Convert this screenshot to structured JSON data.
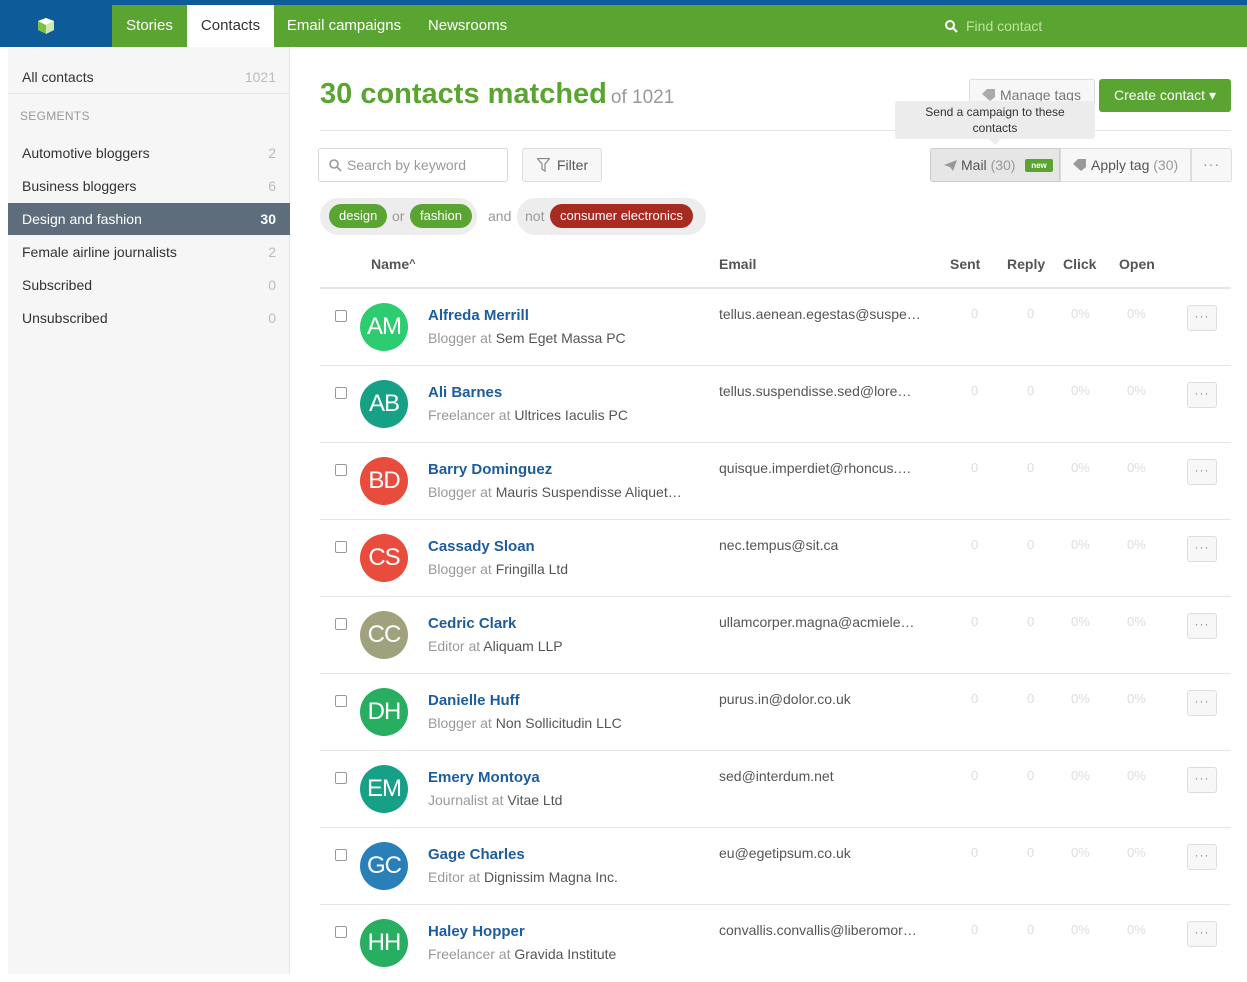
{
  "topnav": {
    "tabs": [
      "Stories",
      "Contacts",
      "Email campaigns",
      "Newsrooms"
    ],
    "active_tab": "Contacts",
    "search_placeholder": "Find contact",
    "colors": {
      "bar": "#5aa532",
      "accent_border": "#0e5b9a"
    }
  },
  "sidebar": {
    "all": {
      "label": "All contacts",
      "count": "1021"
    },
    "segments_heading": "SEGMENTS",
    "items": [
      {
        "label": "Automotive bloggers",
        "count": "2"
      },
      {
        "label": "Business bloggers",
        "count": "6"
      },
      {
        "label": "Design and fashion",
        "count": "30",
        "active": true
      },
      {
        "label": "Female airline journalists",
        "count": "2"
      },
      {
        "label": "Subscribed",
        "count": "0"
      },
      {
        "label": "Unsubscribed",
        "count": "0"
      }
    ]
  },
  "header": {
    "title": "30 contacts matched",
    "of_total": "of 1021",
    "manage_tags": "Manage tags",
    "create_contact": "Create contact ▾",
    "tooltip": "Send a campaign to these contacts"
  },
  "toolbar": {
    "search_placeholder": "Search by keyword",
    "filter": "Filter",
    "mail": "Mail",
    "mail_count": "(30)",
    "new_badge": "new",
    "apply_tag": "Apply tag",
    "apply_count": "(30)",
    "more": "···"
  },
  "filters": {
    "or_tags": [
      "design",
      "fashion"
    ],
    "or_word": "or",
    "and_word": "and",
    "not_word": "not",
    "not_tag": "consumer electronics"
  },
  "table": {
    "columns": {
      "name": "Name",
      "sort_indicator": "^",
      "email": "Email",
      "sent": "Sent",
      "reply": "Reply",
      "click": "Click",
      "open": "Open"
    },
    "rows": [
      {
        "initials": "AM",
        "color": "#2ecc71",
        "name": "Alfreda Merrill",
        "role": "Blogger at",
        "company": "Sem Eget Massa PC",
        "email": "tellus.aenean.egestas@suspe…",
        "sent": "0",
        "reply": "0",
        "click": "0%",
        "open": "0%"
      },
      {
        "initials": "AB",
        "color": "#16a085",
        "name": "Ali Barnes",
        "role": "Freelancer at",
        "company": "Ultrices Iaculis PC",
        "email": "tellus.suspendisse.sed@lore…",
        "sent": "0",
        "reply": "0",
        "click": "0%",
        "open": "0%"
      },
      {
        "initials": "BD",
        "color": "#e74c3c",
        "name": "Barry Dominguez",
        "role": "Blogger at",
        "company": "Mauris Suspendisse Aliquet…",
        "email": "quisque.imperdiet@rhoncus.…",
        "sent": "0",
        "reply": "0",
        "click": "0%",
        "open": "0%"
      },
      {
        "initials": "CS",
        "color": "#e74c3c",
        "name": "Cassady Sloan",
        "role": "Blogger at",
        "company": "Fringilla Ltd",
        "email": "nec.tempus@sit.ca",
        "sent": "0",
        "reply": "0",
        "click": "0%",
        "open": "0%"
      },
      {
        "initials": "CC",
        "color": "#a0a27d",
        "name": "Cedric Clark",
        "role": "Editor at",
        "company": "Aliquam LLP",
        "email": "ullamcorper.magna@acmiele…",
        "sent": "0",
        "reply": "0",
        "click": "0%",
        "open": "0%"
      },
      {
        "initials": "DH",
        "color": "#27ae60",
        "name": "Danielle Huff",
        "role": "Blogger at",
        "company": "Non Sollicitudin LLC",
        "email": "purus.in@dolor.co.uk",
        "sent": "0",
        "reply": "0",
        "click": "0%",
        "open": "0%"
      },
      {
        "initials": "EM",
        "color": "#16a085",
        "name": "Emery Montoya",
        "role": "Journalist at",
        "company": "Vitae Ltd",
        "email": "sed@interdum.net",
        "sent": "0",
        "reply": "0",
        "click": "0%",
        "open": "0%"
      },
      {
        "initials": "GC",
        "color": "#2980b9",
        "name": "Gage Charles",
        "role": "Editor at",
        "company": "Dignissim Magna Inc.",
        "email": "eu@egetipsum.co.uk",
        "sent": "0",
        "reply": "0",
        "click": "0%",
        "open": "0%"
      },
      {
        "initials": "HH",
        "color": "#27ae60",
        "name": "Haley Hopper",
        "role": "Freelancer at",
        "company": "Gravida Institute",
        "email": "convallis.convallis@liberomor…",
        "sent": "0",
        "reply": "0",
        "click": "0%",
        "open": "0%"
      }
    ]
  }
}
